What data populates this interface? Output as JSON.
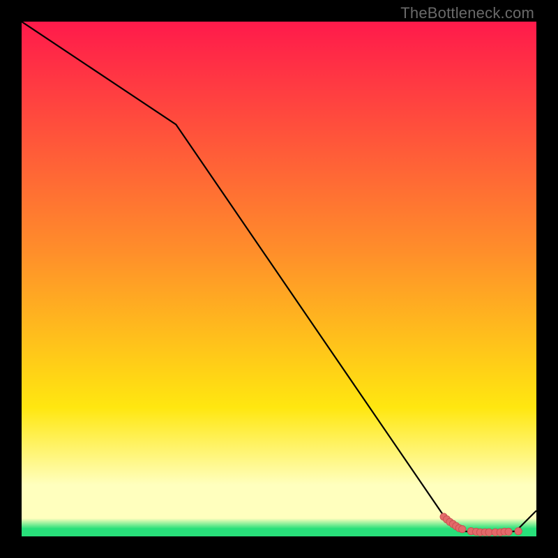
{
  "watermark": "TheBottleneck.com",
  "colors": {
    "frame_black": "#000000",
    "line": "#000000",
    "marker_fill": "#e36a6a",
    "marker_stroke": "#c94e4e",
    "grad_top": "#ff1a4b",
    "grad_mid1": "#ff8f2a",
    "grad_mid2": "#ffe710",
    "grad_pale": "#ffffbe",
    "grad_green": "#28e07a"
  },
  "chart_data": {
    "type": "line",
    "title": "",
    "xlabel": "",
    "ylabel": "",
    "xlim": [
      0,
      100
    ],
    "ylim": [
      0,
      100
    ],
    "x": [
      0,
      30,
      82,
      86,
      88,
      89,
      90,
      91,
      92,
      93,
      96,
      100
    ],
    "values": [
      100,
      80,
      4,
      1.0,
      0.8,
      0.8,
      0.8,
      0.8,
      0.8,
      0.8,
      1.0,
      5
    ],
    "markers": {
      "x": [
        82.0,
        82.6,
        83.2,
        83.8,
        84.4,
        85.0,
        85.6,
        87.3,
        88.3,
        89.1,
        90.0,
        90.8,
        92.0,
        93.0,
        93.8,
        94.6,
        96.5
      ],
      "values": [
        3.8,
        3.3,
        2.8,
        2.4,
        2.0,
        1.6,
        1.4,
        1.0,
        0.9,
        0.8,
        0.8,
        0.8,
        0.8,
        0.8,
        0.9,
        0.9,
        1.0
      ]
    }
  }
}
